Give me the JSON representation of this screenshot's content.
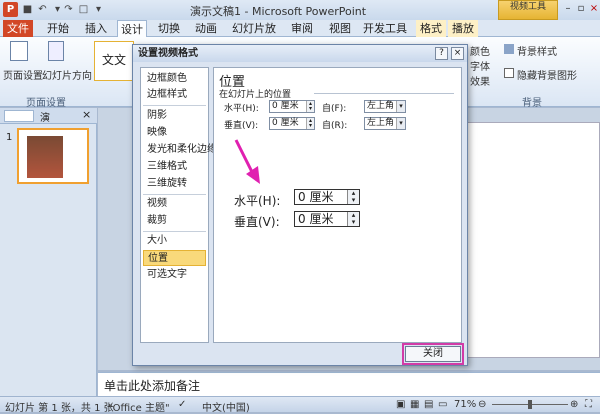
{
  "window": {
    "title": "演示文稿1 - Microsoft PowerPoint",
    "contextual_group": "视频工具"
  },
  "tabs": [
    "文件",
    "开始",
    "插入",
    "设计",
    "切换",
    "动画",
    "幻灯片放映",
    "审阅",
    "视图",
    "开发工具",
    "格式",
    "播放"
  ],
  "ribbon": {
    "page_setup": "页面设置",
    "orientation": "幻灯片方向",
    "page_setup_group": "页面设置",
    "theme_label": "文文",
    "colors": "颜色",
    "fonts": "字体",
    "effects": "效果",
    "bg_styles": "背景样式",
    "hide_bg": "隐藏背景图形",
    "bg_group": "背景"
  },
  "leftpane": {
    "tab_outline": "演",
    "slide_number": "1"
  },
  "dialog": {
    "title": "设置视频格式",
    "help": "?",
    "close_x": "×",
    "nav": [
      "边框颜色",
      "边框样式",
      "阴影",
      "映像",
      "发光和柔化边缘",
      "三维格式",
      "三维旋转",
      "视频",
      "裁剪",
      "大小",
      "位置",
      "可选文字"
    ],
    "section_title": "位置",
    "subsection": "在幻灯片上的位置",
    "horizontal_label": "水平(H):",
    "vertical_label": "垂直(V):",
    "from_label": "自(F):",
    "from_label2": "自(R):",
    "horizontal_value": "0 厘米",
    "vertical_value": "0 厘米",
    "from_value": "左上角",
    "big_horizontal_label": "水平(H):",
    "big_vertical_label": "垂直(V):",
    "big_horizontal_value": "0 厘米",
    "big_vertical_value": "0 厘米",
    "close_button": "关闭"
  },
  "notes": {
    "placeholder": "单击此处添加备注"
  },
  "status": {
    "slide_info": "幻灯片 第 1 张，共 1 张",
    "theme": "\"Office 主题\"",
    "language": "中文(中国)",
    "zoom": "71%"
  },
  "colors": {
    "accent_file": "#d24726",
    "highlight": "#d23ba7",
    "selected_nav": "#f9d97b"
  }
}
